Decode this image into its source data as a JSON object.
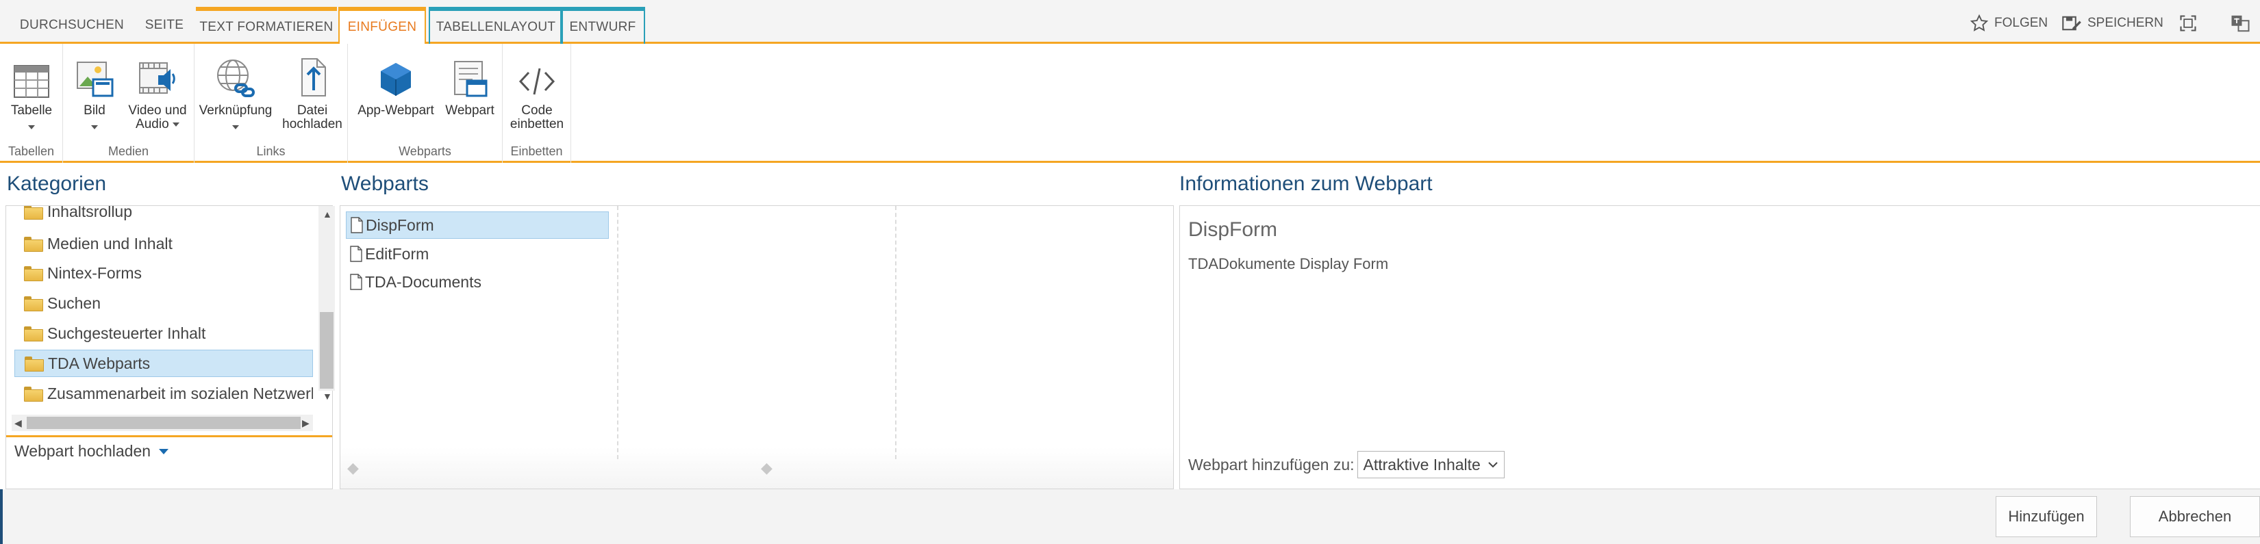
{
  "tabs": [
    {
      "label": "DURCHSUCHEN"
    },
    {
      "label": "SEITE"
    },
    {
      "label": "TEXT FORMATIEREN"
    },
    {
      "label": "EINFÜGEN"
    },
    {
      "label": "TABELLENLAYOUT"
    },
    {
      "label": "ENTWURF"
    }
  ],
  "active_tab": "EINFÜGEN",
  "top_actions": {
    "follow": "FOLGEN",
    "save": "SPEICHERN"
  },
  "ribbon": {
    "groups": [
      {
        "label": "Tabellen",
        "buttons": [
          {
            "label": "Tabelle",
            "icon": "table-icon"
          }
        ]
      },
      {
        "label": "Medien",
        "buttons": [
          {
            "label": "Bild",
            "icon": "picture-icon"
          },
          {
            "label_line1": "Video und",
            "label_line2": "Audio",
            "icon": "video-audio-icon"
          }
        ]
      },
      {
        "label": "Links",
        "buttons": [
          {
            "label": "Verknüpfung",
            "icon": "link-icon"
          },
          {
            "label_line1": "Datei",
            "label_line2": "hochladen",
            "icon": "upload-icon"
          }
        ]
      },
      {
        "label": "Webparts",
        "buttons": [
          {
            "label": "App-Webpart",
            "icon": "app-part-icon"
          },
          {
            "label": "Webpart",
            "icon": "webpart-icon"
          }
        ]
      },
      {
        "label": "Einbetten",
        "buttons": [
          {
            "label_line1": "Code",
            "label_line2": "einbetten",
            "icon": "code-icon"
          }
        ]
      }
    ]
  },
  "categories": {
    "title": "Kategorien",
    "items": [
      {
        "label": "Inhaltsrollup"
      },
      {
        "label": "Medien und Inhalt"
      },
      {
        "label": "Nintex-Forms"
      },
      {
        "label": "Suchen"
      },
      {
        "label": "Suchgesteuerter Inhalt"
      },
      {
        "label": "TDA Webparts"
      },
      {
        "label": "Zusammenarbeit im sozialen Netzwerk"
      }
    ],
    "selected": "TDA Webparts",
    "upload_label": "Webpart hochladen"
  },
  "webparts": {
    "title": "Webparts",
    "items": [
      {
        "label": "DispForm"
      },
      {
        "label": "EditForm"
      },
      {
        "label": "TDA-Documents"
      }
    ],
    "selected": "DispForm"
  },
  "info": {
    "title": "Informationen zum Webpart",
    "name": "DispForm",
    "description": "TDADokumente Display Form",
    "add_to_label": "Webpart hinzufügen zu:",
    "add_to_value": "Attraktive Inhalte"
  },
  "footer": {
    "add_button": "Hinzufügen",
    "cancel_button": "Abbrechen"
  },
  "colors": {
    "accent": "#f5a623",
    "active_tab_text": "#e87a1e",
    "context_tab": "#2aa0b8",
    "heading": "#1e4e79",
    "selection": "#cde6f7",
    "icon_blue": "#1a6bb0"
  }
}
